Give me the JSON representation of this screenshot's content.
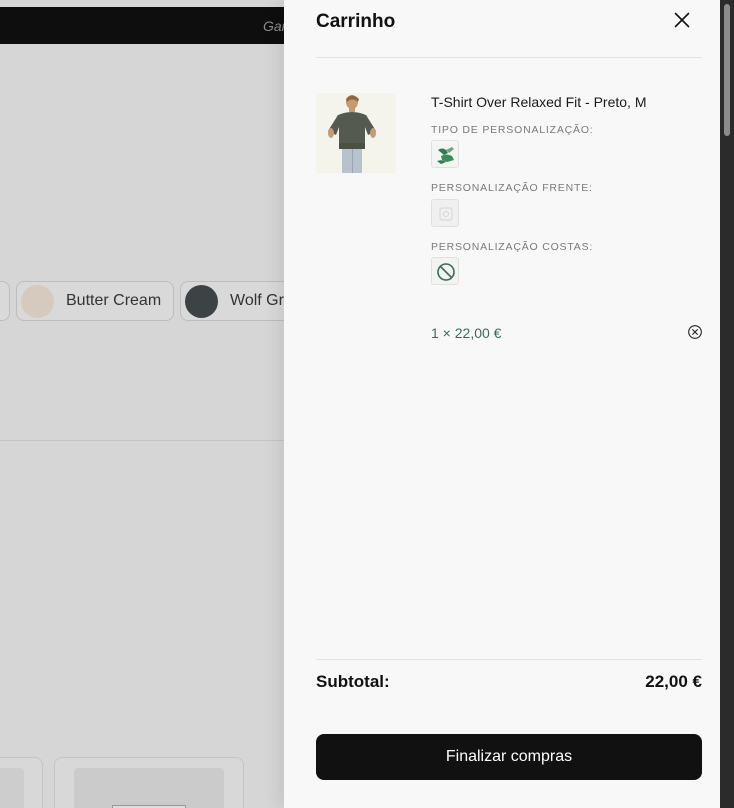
{
  "background": {
    "topbar_text": "Gar",
    "swatches": [
      {
        "label": "",
        "color": "#d0d0d0"
      },
      {
        "label": "Butter Cream",
        "color": "#d6c9bd"
      },
      {
        "label": "Wolf Gre",
        "color": "#3d4244"
      }
    ]
  },
  "cart": {
    "title": "Carrinho",
    "close_icon": "close-icon",
    "items": [
      {
        "name": "T-Shirt Over Relaxed Fit - Preto, M",
        "options": [
          {
            "label": "TIPO DE PERSONALIZAÇÃO:",
            "icon": "embroidery-type-icon"
          },
          {
            "label": "PERSONALIZAÇÃO FRENTE:",
            "icon": "front-design-icon"
          },
          {
            "label": "PERSONALIZAÇÃO COSTAS:",
            "icon": "no-design-icon"
          }
        ],
        "quantity_price": "1 × 22,00 €",
        "remove_icon": "remove-circle-icon"
      }
    ],
    "subtotal_label": "Subtotal:",
    "subtotal_value": "22,00 €",
    "checkout_label": "Finalizar compras"
  },
  "colors": {
    "accent_green": "#3f6b55",
    "button_bg": "#111111"
  }
}
